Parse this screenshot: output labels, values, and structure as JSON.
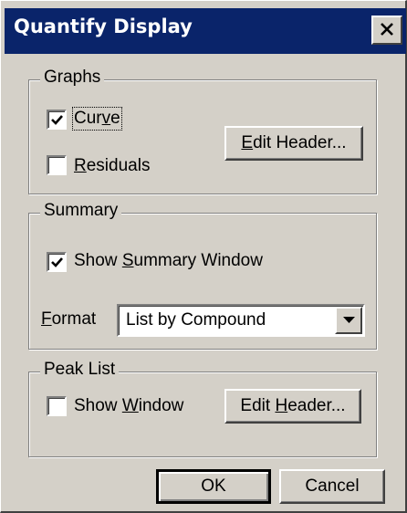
{
  "window": {
    "title": "Quantify Display",
    "close_icon": "close-icon"
  },
  "graphs": {
    "legend": "Graphs",
    "curve": {
      "pre": "Cur",
      "u": "v",
      "post": "e",
      "checked": true
    },
    "residuals": {
      "pre": "",
      "u": "R",
      "post": "esiduals",
      "checked": false
    },
    "edit_header": {
      "pre": "",
      "u": "E",
      "post": "dit Header..."
    }
  },
  "summary": {
    "legend": "Summary",
    "show_summary": {
      "pre": "Show ",
      "u": "S",
      "post": "ummary Window",
      "checked": true
    },
    "format_label": {
      "pre": "",
      "u": "F",
      "post": "ormat"
    },
    "format_value": "List by Compound"
  },
  "peak_list": {
    "legend": "Peak List",
    "show_window": {
      "pre": "Show ",
      "u": "W",
      "post": "indow",
      "checked": false
    },
    "edit_header": {
      "pre": "Edit ",
      "u": "H",
      "post": "eader..."
    }
  },
  "buttons": {
    "ok": "OK",
    "cancel": "Cancel"
  }
}
